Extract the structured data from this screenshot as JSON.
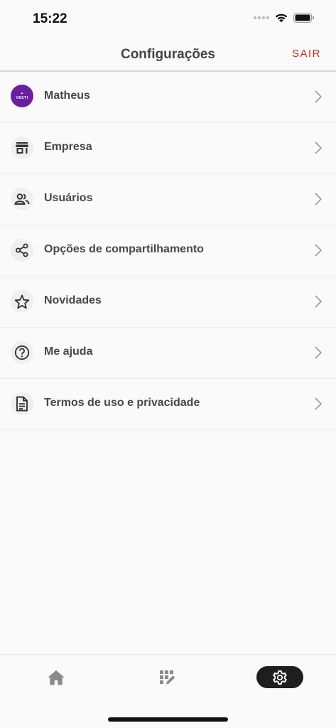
{
  "status_bar": {
    "time": "15:22"
  },
  "header": {
    "title": "Configurações",
    "logout_label": "SAIR"
  },
  "avatar": {
    "logo_text": "VESTI"
  },
  "menu": {
    "items": [
      {
        "label": "Matheus",
        "icon": "avatar"
      },
      {
        "label": "Empresa",
        "icon": "store-icon"
      },
      {
        "label": "Usuários",
        "icon": "users-icon"
      },
      {
        "label": "Opções de compartilhamento",
        "icon": "share-icon"
      },
      {
        "label": "Novidades",
        "icon": "star-icon"
      },
      {
        "label": "Me ajuda",
        "icon": "help-icon"
      },
      {
        "label": "Termos de uso e privacidade",
        "icon": "document-icon"
      }
    ]
  },
  "tab_bar": {
    "tabs": [
      {
        "name": "home",
        "icon": "home-icon",
        "selected": false
      },
      {
        "name": "catalog",
        "icon": "grid-edit-icon",
        "selected": false
      },
      {
        "name": "settings",
        "icon": "gear-icon",
        "selected": true
      }
    ]
  },
  "colors": {
    "accent": "#c8281e",
    "avatar_bg": "#6b1f9e",
    "tab_selected_bg": "#1e1e1e"
  }
}
